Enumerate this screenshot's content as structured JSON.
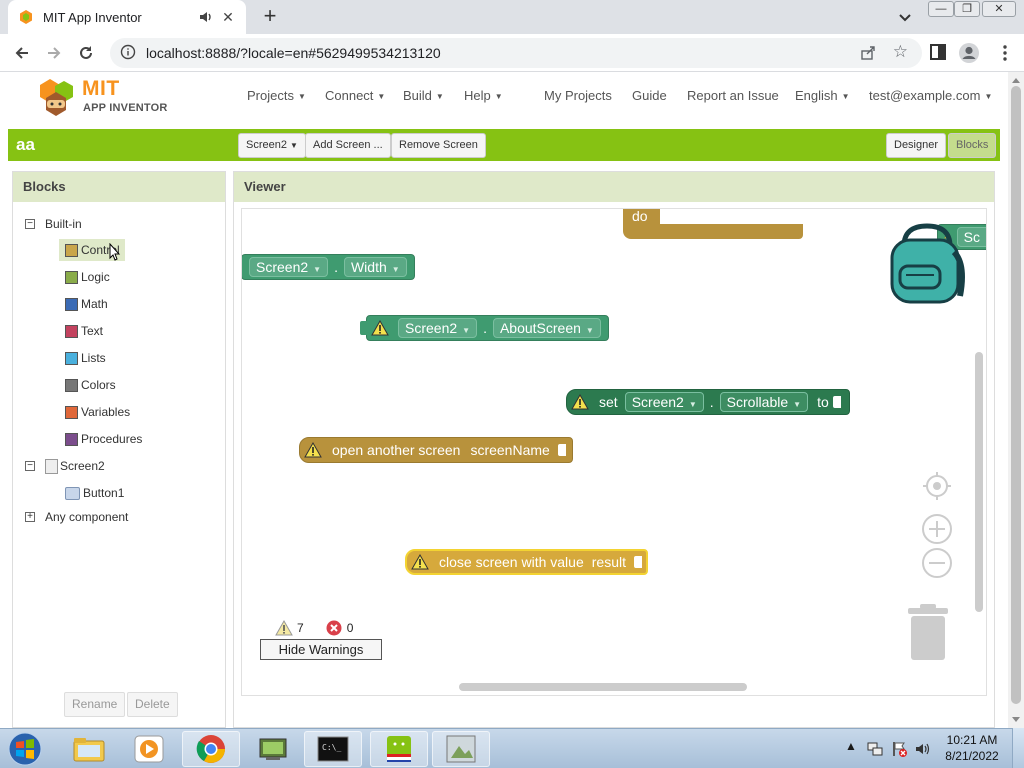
{
  "browser": {
    "tab_title": "MIT App Inventor",
    "url": "localhost:8888/?locale=en#5629499534213120"
  },
  "header": {
    "logo_top": "MIT",
    "logo_bottom": "APP INVENTOR",
    "menus": [
      "Projects",
      "Connect",
      "Build",
      "Help"
    ],
    "links": [
      "My Projects",
      "Guide",
      "Report an Issue"
    ],
    "language": "English",
    "account": "test@example.com"
  },
  "project": {
    "name": "aa",
    "screen_select": "Screen2",
    "add_screen": "Add Screen ...",
    "remove_screen": "Remove Screen",
    "designer": "Designer",
    "blocks": "Blocks"
  },
  "left_panel": {
    "title": "Blocks",
    "builtin": "Built-in",
    "drawers": [
      {
        "label": "Control",
        "color": "#c9a64b"
      },
      {
        "label": "Logic",
        "color": "#8aac4a"
      },
      {
        "label": "Math",
        "color": "#3b6bb5"
      },
      {
        "label": "Text",
        "color": "#c3425f"
      },
      {
        "label": "Lists",
        "color": "#4ab0dd"
      },
      {
        "label": "Colors",
        "color": "#777777"
      },
      {
        "label": "Variables",
        "color": "#e0683a"
      },
      {
        "label": "Procedures",
        "color": "#7b4d8c"
      }
    ],
    "screen": "Screen2",
    "component": "Button1",
    "any_component": "Any component",
    "rename": "Rename",
    "delete": "Delete"
  },
  "viewer": {
    "title": "Viewer",
    "do_label": "do",
    "width_block": {
      "component": "Screen2",
      "property": "Width"
    },
    "about_block": {
      "component": "Screen2",
      "property": "AboutScreen"
    },
    "set_block": {
      "set": "set",
      "component": "Screen2",
      "property": "Scrollable",
      "to": "to"
    },
    "open_block": {
      "text": "open another screen",
      "param": "screenName"
    },
    "close_block": {
      "text": "close screen with value",
      "param": "result"
    },
    "backpack_peek": "Sc",
    "warnings_count": "7",
    "errors_count": "0",
    "hide_warnings": "Hide Warnings"
  },
  "taskbar": {
    "time": "10:21 AM",
    "date": "8/21/2022"
  }
}
